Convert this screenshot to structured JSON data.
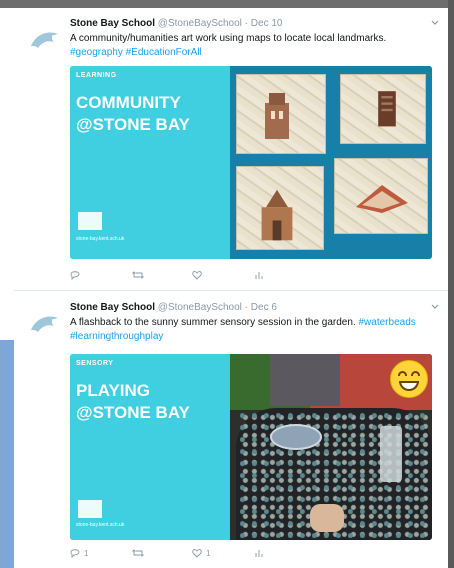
{
  "tweets": [
    {
      "author_name": "Stone Bay School",
      "author_handle": "@StoneBaySchool",
      "date": "· Dec 10",
      "text": "A community/humanities art work using maps to locate local landmarks.",
      "hashtags": [
        "#geography",
        "#EducationForAll"
      ],
      "media": {
        "label": "LEARNING",
        "title_line1": "COMMUNITY",
        "title_line2": "@STONE BAY",
        "url": "stone-bay.kent.sch.uk"
      },
      "actions": {
        "reply_count": "",
        "retweet_count": "",
        "like_count": ""
      }
    },
    {
      "author_name": "Stone Bay School",
      "author_handle": "@StoneBaySchool",
      "date": "· Dec 6",
      "text": "A flashback to the sunny summer sensory session in the garden.",
      "hashtags": [
        "#waterbeads",
        "#learningthroughplay"
      ],
      "media": {
        "label": "SENSORY",
        "title_line1": "PLAYING",
        "title_line2": "@STONE BAY",
        "url": "stone-bay.kent.sch.uk"
      },
      "actions": {
        "reply_count": "1",
        "retweet_count": "",
        "like_count": "1"
      }
    }
  ],
  "colors": {
    "link": "#1da1f2",
    "teal": "#3fcfe0",
    "board_blue": "#177fa8",
    "muted": "#8a9aa6"
  },
  "icons": [
    "dolphin-avatar-icon",
    "chevron-down-icon",
    "reply-icon",
    "retweet-icon",
    "like-icon",
    "analytics-icon"
  ]
}
